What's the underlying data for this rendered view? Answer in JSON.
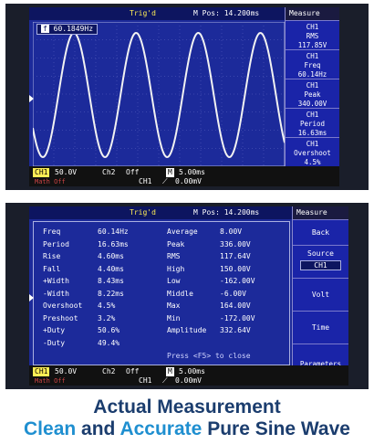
{
  "top": {
    "trig": "Trig'd",
    "mpos": "M Pos: 14.200ms",
    "freq_readout": "60.1849Hz",
    "side_title": "Measure",
    "side_items": [
      {
        "l1": "CH1",
        "l2": "RMS",
        "l3": "117.85V"
      },
      {
        "l1": "CH1",
        "l2": "Freq",
        "l3": "60.14Hz"
      },
      {
        "l1": "CH1",
        "l2": "Peak",
        "l3": "340.00V"
      },
      {
        "l1": "CH1",
        "l2": "Period",
        "l3": "16.63ms"
      },
      {
        "l1": "CH1",
        "l2": "Overshoot",
        "l3": "4.5%"
      }
    ],
    "bottom": {
      "ch1": "CH1",
      "ch1_val": "50.0V",
      "ch2": "Ch2",
      "ch2_val": "Off",
      "m": "M",
      "m_val": "5.00ms",
      "math": "Math Off",
      "trig_ch": "CH1",
      "trig_val": "0.00mV"
    }
  },
  "bottom_scope": {
    "trig": "Trig'd",
    "mpos": "M Pos: 14.200ms",
    "side_title": "Measure",
    "side_items": [
      "Back",
      "Source",
      "CH1",
      "Volt",
      "Time",
      "Parameters"
    ],
    "rows_left": [
      {
        "k": "Freq",
        "v": "60.14Hz"
      },
      {
        "k": "Period",
        "v": "16.63ms"
      },
      {
        "k": "Rise",
        "v": "4.60ms"
      },
      {
        "k": "Fall",
        "v": "4.40ms"
      },
      {
        "k": "+Width",
        "v": "8.43ms"
      },
      {
        "k": "-Width",
        "v": "8.22ms"
      },
      {
        "k": "Overshoot",
        "v": "4.5%"
      },
      {
        "k": "Preshoot",
        "v": "3.2%"
      },
      {
        "k": "+Duty",
        "v": "50.6%"
      },
      {
        "k": "-Duty",
        "v": "49.4%"
      }
    ],
    "rows_right": [
      {
        "k": "Average",
        "v": "8.00V"
      },
      {
        "k": "Peak",
        "v": "336.00V"
      },
      {
        "k": "RMS",
        "v": "117.64V"
      },
      {
        "k": "High",
        "v": "150.00V"
      },
      {
        "k": "Low",
        "v": "-162.00V"
      },
      {
        "k": "Middle",
        "v": "-6.00V"
      },
      {
        "k": "Max",
        "v": "164.00V"
      },
      {
        "k": "Min",
        "v": "-172.00V"
      },
      {
        "k": "Amplitude",
        "v": "332.64V"
      }
    ],
    "hint": "Press <F5> to close",
    "bottom": {
      "ch1": "CH1",
      "ch1_val": "50.0V",
      "ch2": "Ch2",
      "ch2_val": "Off",
      "m": "M",
      "m_val": "5.00ms",
      "math": "Math Off",
      "trig_ch": "CH1",
      "trig_val": "0.00mV"
    }
  },
  "caption": {
    "line1": "Actual Measurement",
    "clean": "Clean",
    "and": "and",
    "accurate": "Accurate",
    "rest": "Pure Sine Wave"
  },
  "colors": {
    "screen": "#1c2a9a",
    "trace": "#f2f2f2",
    "caption": "#1b3d6e",
    "highlight": "#1f8fd0"
  }
}
